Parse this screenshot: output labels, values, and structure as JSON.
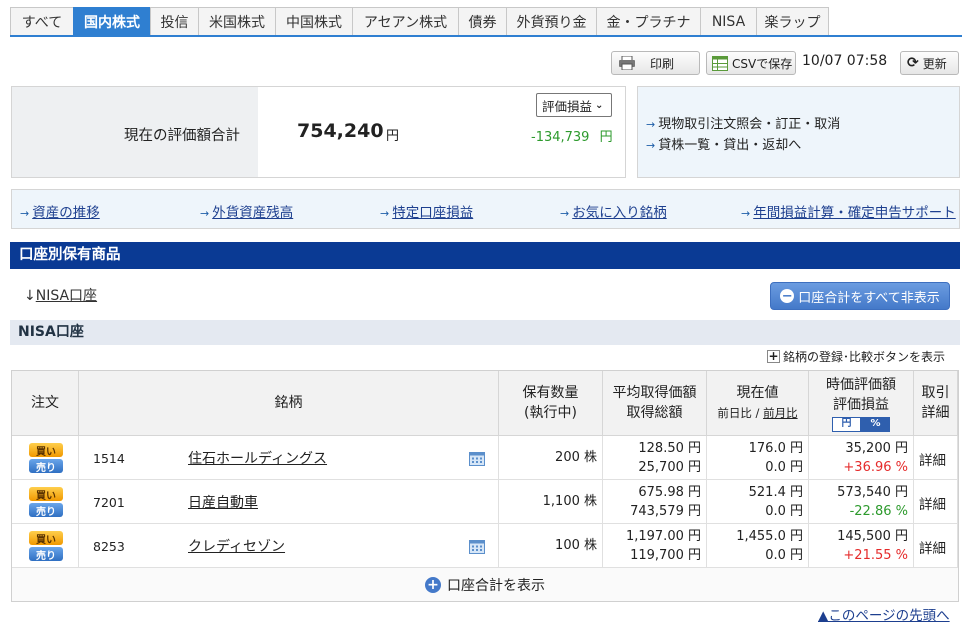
{
  "tabs": [
    {
      "label": "すべて",
      "active": false
    },
    {
      "label": "国内株式",
      "active": true
    },
    {
      "label": "投信",
      "active": false
    },
    {
      "label": "米国株式",
      "active": false
    },
    {
      "label": "中国株式",
      "active": false
    },
    {
      "label": "アセアン株式",
      "active": false
    },
    {
      "label": "債券",
      "active": false
    },
    {
      "label": "外貨預り金",
      "active": false
    },
    {
      "label": "金・プラチナ",
      "active": false
    },
    {
      "label": "NISA",
      "active": false
    },
    {
      "label": "楽ラップ",
      "active": false
    }
  ],
  "toolbar": {
    "print_label": "印刷",
    "csv_label": "CSVで保存",
    "timestamp": "10/07 07:58",
    "refresh_label": "更新"
  },
  "summary": {
    "label": "現在の評価額合計",
    "value": "754,240",
    "unit": "円",
    "select_value": "評価損益",
    "change": "-134,739",
    "change_unit": "円"
  },
  "side_links": [
    "現物取引注文照会・訂正・取消",
    "貸株一覧・貸出・返却へ"
  ],
  "nav_links": [
    "資産の推移",
    "外貨資産残高",
    "特定口座損益",
    "お気に入り銘柄",
    "年間損益計算・確定申告サポート"
  ],
  "section_title": "口座別保有商品",
  "nisa_link": "NISA口座",
  "hide_all_button": "口座合計をすべて非表示",
  "nisa_header": "NISA口座",
  "register_button": "銘柄の登録･比較ボタンを表示",
  "table": {
    "headers": {
      "order": "注文",
      "name": "銘柄",
      "qty_line1": "保有数量",
      "qty_line2": "(執行中)",
      "avg_line1": "平均取得価額",
      "avg_line2": "取得総額",
      "cur_line1": "現在値",
      "cur_line2a": "前日比",
      "cur_sep": " / ",
      "cur_line2b": "前月比",
      "eval_line1": "時価評価額",
      "eval_line2": "評価損益",
      "toggle_yen": "円",
      "toggle_pct": "%",
      "detail_line1": "取引",
      "detail_line2": "詳細"
    },
    "buy_label": "買い",
    "sell_label": "売り",
    "rows": [
      {
        "code": "1514",
        "name": "住石ホールディングス",
        "qty": "200 株",
        "avg_price": "128.50 円",
        "total_cost": "25,700 円",
        "current": "176.0 円",
        "day_change": "0.0 円",
        "market_value": "35,200 円",
        "pl_pct": "+36.96 %",
        "pl_sign": "pos",
        "detail": "詳細",
        "has_calendar": true
      },
      {
        "code": "7201",
        "name": "日産自動車",
        "qty": "1,100 株",
        "avg_price": "675.98 円",
        "total_cost": "743,579 円",
        "current": "521.4 円",
        "day_change": "0.0 円",
        "market_value": "573,540 円",
        "pl_pct": "-22.86 %",
        "pl_sign": "neg",
        "detail": "詳細",
        "has_calendar": false
      },
      {
        "code": "8253",
        "name": "クレディセゾン",
        "qty": "100 株",
        "avg_price": "1,197.00 円",
        "total_cost": "119,700 円",
        "current": "1,455.0 円",
        "day_change": "0.0 円",
        "market_value": "145,500 円",
        "pl_pct": "+21.55 %",
        "pl_sign": "pos",
        "detail": "詳細",
        "has_calendar": true
      }
    ],
    "footer_label": "口座合計を表示"
  },
  "page_top": "▲このページの先頭へ",
  "colors": {
    "accent": "#2f7fd1",
    "section_bar": "#0a3a94",
    "positive": "#e52b2b",
    "negative": "#2d9a2d"
  }
}
